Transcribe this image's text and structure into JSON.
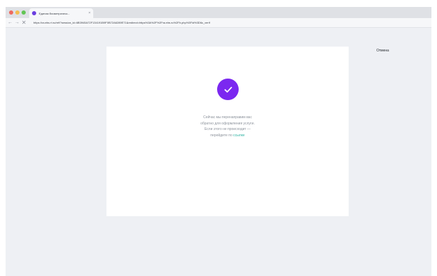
{
  "browser": {
    "tab_title": "Единая биометрическ...",
    "tab_close": "×",
    "url": "https://ra.ebs.rt.ru/ref/?session_id=6B3945A72F134191B9F0B72A6289E71&redirect=https%3A%2F%2Fra.ebs.ru%2Fb.php%3Fid%3D6c_verif",
    "nav": {
      "back": "←",
      "forward": "→",
      "stop": "✕"
    }
  },
  "page": {
    "cancel_label": "Отмена",
    "message_lines": [
      "Сейчас мы перенаправим вас",
      "обратно для оформления услуги.",
      "Если этого не происходит —"
    ],
    "link_prefix": "перейдите по ",
    "link_text": "ссылке"
  },
  "colors": {
    "accent": "#7b28f0",
    "link": "#2fb3a2",
    "background": "#eef0f4"
  },
  "icons": {
    "success": "checkmark-icon"
  }
}
